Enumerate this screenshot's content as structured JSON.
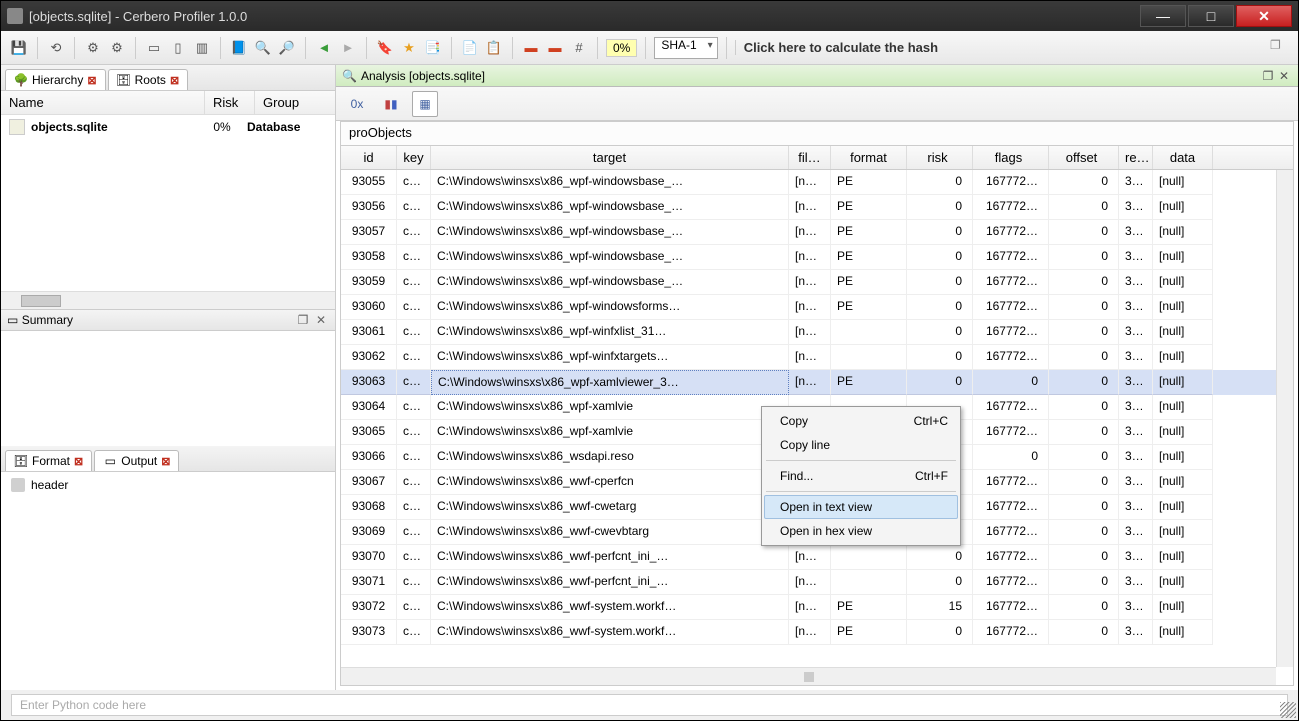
{
  "window": {
    "title": "[objects.sqlite] - Cerbero Profiler 1.0.0"
  },
  "toolbar": {
    "pct": "0%",
    "hash_algo": "SHA-1",
    "hash_hint": "Click here to calculate the hash"
  },
  "left": {
    "tab_hierarchy": "Hierarchy",
    "tab_roots": "Roots",
    "hier_cols": {
      "name": "Name",
      "risk": "Risk",
      "group": "Group"
    },
    "hier_row": {
      "name": "objects.sqlite",
      "risk": "0%",
      "group": "Database"
    },
    "summary_title": "Summary",
    "tab_format": "Format",
    "tab_output": "Output",
    "format_item": "header"
  },
  "analysis": {
    "label": "Analysis [objects.sqlite]"
  },
  "view_toolbar": {
    "hex": "0x"
  },
  "grid": {
    "label": "proObjects",
    "cols": {
      "id": "id",
      "key": "key",
      "target": "target",
      "fil": "fil…",
      "format": "format",
      "risk": "risk",
      "flags": "flags",
      "offset": "offset",
      "re": "re…",
      "data": "data"
    },
    "rows": [
      {
        "id": "93055",
        "key": "c…",
        "target": "C:\\Windows\\winsxs\\x86_wpf-windowsbase_…",
        "fil": "[n…",
        "format": "PE",
        "risk": "0",
        "flags": "167772…",
        "offset": "0",
        "re": "3…",
        "data": "[null]"
      },
      {
        "id": "93056",
        "key": "c…",
        "target": "C:\\Windows\\winsxs\\x86_wpf-windowsbase_…",
        "fil": "[n…",
        "format": "PE",
        "risk": "0",
        "flags": "167772…",
        "offset": "0",
        "re": "3…",
        "data": "[null]"
      },
      {
        "id": "93057",
        "key": "c…",
        "target": "C:\\Windows\\winsxs\\x86_wpf-windowsbase_…",
        "fil": "[n…",
        "format": "PE",
        "risk": "0",
        "flags": "167772…",
        "offset": "0",
        "re": "3…",
        "data": "[null]"
      },
      {
        "id": "93058",
        "key": "c…",
        "target": "C:\\Windows\\winsxs\\x86_wpf-windowsbase_…",
        "fil": "[n…",
        "format": "PE",
        "risk": "0",
        "flags": "167772…",
        "offset": "0",
        "re": "3…",
        "data": "[null]"
      },
      {
        "id": "93059",
        "key": "c…",
        "target": "C:\\Windows\\winsxs\\x86_wpf-windowsbase_…",
        "fil": "[n…",
        "format": "PE",
        "risk": "0",
        "flags": "167772…",
        "offset": "0",
        "re": "3…",
        "data": "[null]"
      },
      {
        "id": "93060",
        "key": "c…",
        "target": "C:\\Windows\\winsxs\\x86_wpf-windowsforms…",
        "fil": "[n…",
        "format": "PE",
        "risk": "0",
        "flags": "167772…",
        "offset": "0",
        "re": "3…",
        "data": "[null]"
      },
      {
        "id": "93061",
        "key": "c…",
        "target": "C:\\Windows\\winsxs\\x86_wpf-winfxlist_31…",
        "fil": "[n…",
        "format": "",
        "risk": "0",
        "flags": "167772…",
        "offset": "0",
        "re": "3…",
        "data": "[null]"
      },
      {
        "id": "93062",
        "key": "c…",
        "target": "C:\\Windows\\winsxs\\x86_wpf-winfxtargets…",
        "fil": "[n…",
        "format": "",
        "risk": "0",
        "flags": "167772…",
        "offset": "0",
        "re": "3…",
        "data": "[null]"
      },
      {
        "id": "93063",
        "key": "c…",
        "target": "C:\\Windows\\winsxs\\x86_wpf-xamlviewer_3…",
        "fil": "[n…",
        "format": "PE",
        "risk": "0",
        "flags": "0",
        "offset": "0",
        "re": "3…",
        "data": "[null]",
        "selected": true
      },
      {
        "id": "93064",
        "key": "c…",
        "target": "C:\\Windows\\winsxs\\x86_wpf-xamlvie",
        "fil": "",
        "format": "",
        "risk": "",
        "flags": "167772…",
        "offset": "0",
        "re": "3…",
        "data": "[null]"
      },
      {
        "id": "93065",
        "key": "c…",
        "target": "C:\\Windows\\winsxs\\x86_wpf-xamlvie",
        "fil": "",
        "format": "",
        "risk": "",
        "flags": "167772…",
        "offset": "0",
        "re": "3…",
        "data": "[null]"
      },
      {
        "id": "93066",
        "key": "c…",
        "target": "C:\\Windows\\winsxs\\x86_wsdapi.reso",
        "fil": "",
        "format": "",
        "risk": "",
        "flags": "0",
        "offset": "0",
        "re": "3…",
        "data": "[null]"
      },
      {
        "id": "93067",
        "key": "c…",
        "target": "C:\\Windows\\winsxs\\x86_wwf-cperfcn",
        "fil": "",
        "format": "",
        "risk": "",
        "flags": "167772…",
        "offset": "0",
        "re": "3…",
        "data": "[null]"
      },
      {
        "id": "93068",
        "key": "c…",
        "target": "C:\\Windows\\winsxs\\x86_wwf-cwetarg",
        "fil": "",
        "format": "",
        "risk": "",
        "flags": "167772…",
        "offset": "0",
        "re": "3…",
        "data": "[null]"
      },
      {
        "id": "93069",
        "key": "c…",
        "target": "C:\\Windows\\winsxs\\x86_wwf-cwevbtarg",
        "fil": "",
        "format": "",
        "risk": "",
        "flags": "167772…",
        "offset": "0",
        "re": "3…",
        "data": "[null]"
      },
      {
        "id": "93070",
        "key": "c…",
        "target": "C:\\Windows\\winsxs\\x86_wwf-perfcnt_ini_…",
        "fil": "[n…",
        "format": "",
        "risk": "0",
        "flags": "167772…",
        "offset": "0",
        "re": "3…",
        "data": "[null]"
      },
      {
        "id": "93071",
        "key": "c…",
        "target": "C:\\Windows\\winsxs\\x86_wwf-perfcnt_ini_…",
        "fil": "[n…",
        "format": "",
        "risk": "0",
        "flags": "167772…",
        "offset": "0",
        "re": "3…",
        "data": "[null]"
      },
      {
        "id": "93072",
        "key": "c…",
        "target": "C:\\Windows\\winsxs\\x86_wwf-system.workf…",
        "fil": "[n…",
        "format": "PE",
        "risk": "15",
        "flags": "167772…",
        "offset": "0",
        "re": "3…",
        "data": "[null]"
      },
      {
        "id": "93073",
        "key": "c…",
        "target": "C:\\Windows\\winsxs\\x86_wwf-system.workf…",
        "fil": "[n…",
        "format": "PE",
        "risk": "0",
        "flags": "167772…",
        "offset": "0",
        "re": "3…",
        "data": "[null]"
      }
    ]
  },
  "context_menu": {
    "copy": "Copy",
    "copy_sc": "Ctrl+C",
    "copy_line": "Copy line",
    "find": "Find...",
    "find_sc": "Ctrl+F",
    "open_text": "Open in text view",
    "open_hex": "Open in hex view"
  },
  "status": {
    "placeholder": "Enter Python code here"
  }
}
